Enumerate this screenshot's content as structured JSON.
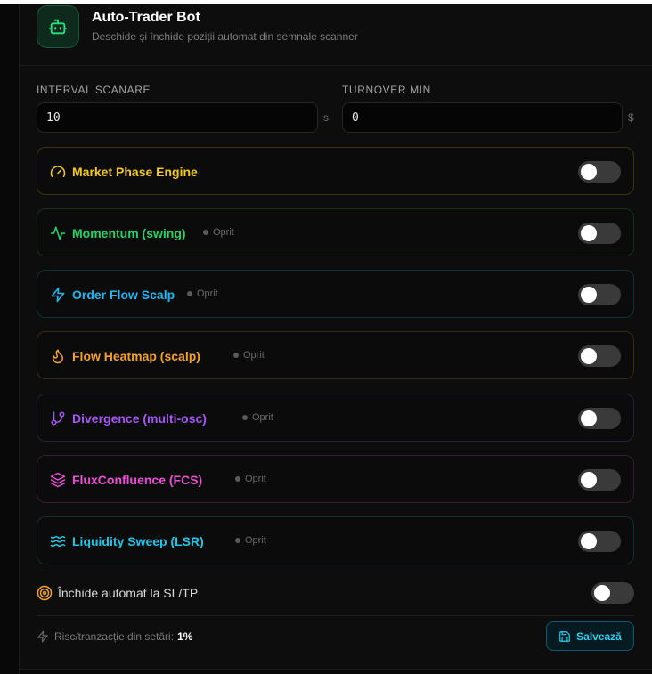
{
  "bot": {
    "title": "Auto-Trader Bot",
    "subtitle": "Deschide și închide poziții automat din semnale scanner",
    "icon": "robot-icon"
  },
  "fields": {
    "interval": {
      "label": "INTERVAL SCANARE",
      "value": "10",
      "unit": "s"
    },
    "turnover": {
      "label": "TURNOVER MIN",
      "value": "0",
      "unit": "$"
    }
  },
  "strategies": [
    {
      "name": "Market Phase Engine",
      "status": "",
      "color": "#f2c81a",
      "border": "#3a3410",
      "icon": "gauge-icon",
      "enabled": false
    },
    {
      "name": "Momentum (swing)",
      "status": "Oprit",
      "color": "#22d469",
      "border": "#16301f",
      "icon": "activity-icon",
      "enabled": false
    },
    {
      "name": "Order Flow Scalp",
      "status": "Oprit",
      "color": "#1fb6f2",
      "border": "#15303a",
      "icon": "zap-icon",
      "enabled": false
    },
    {
      "name": "Flow Heatmap (scalp)",
      "status": "Oprit",
      "color": "#f2a22a",
      "border": "#3a2a12",
      "icon": "flame-icon",
      "enabled": false
    },
    {
      "name": "Divergence (multi-osc)",
      "status": "Oprit",
      "color": "#a855f7",
      "border": "#2a1f3a",
      "icon": "git-branch-icon",
      "enabled": false
    },
    {
      "name": "FluxConfluence (FCS)",
      "status": "Oprit",
      "color": "#ec4fd6",
      "border": "#3a1a36",
      "icon": "layers-icon",
      "enabled": false
    },
    {
      "name": "Liquidity Sweep (LSR)",
      "status": "Oprit",
      "color": "#22c6e6",
      "border": "#123038",
      "icon": "waves-icon",
      "enabled": false
    }
  ],
  "autoclose": {
    "label": "Închide automat la SL/TP",
    "enabled": false,
    "icon": "target-icon"
  },
  "footer": {
    "risk_label": "Risc/tranzacție din setări:",
    "risk_value": "1%",
    "save_label": "Salvează"
  }
}
